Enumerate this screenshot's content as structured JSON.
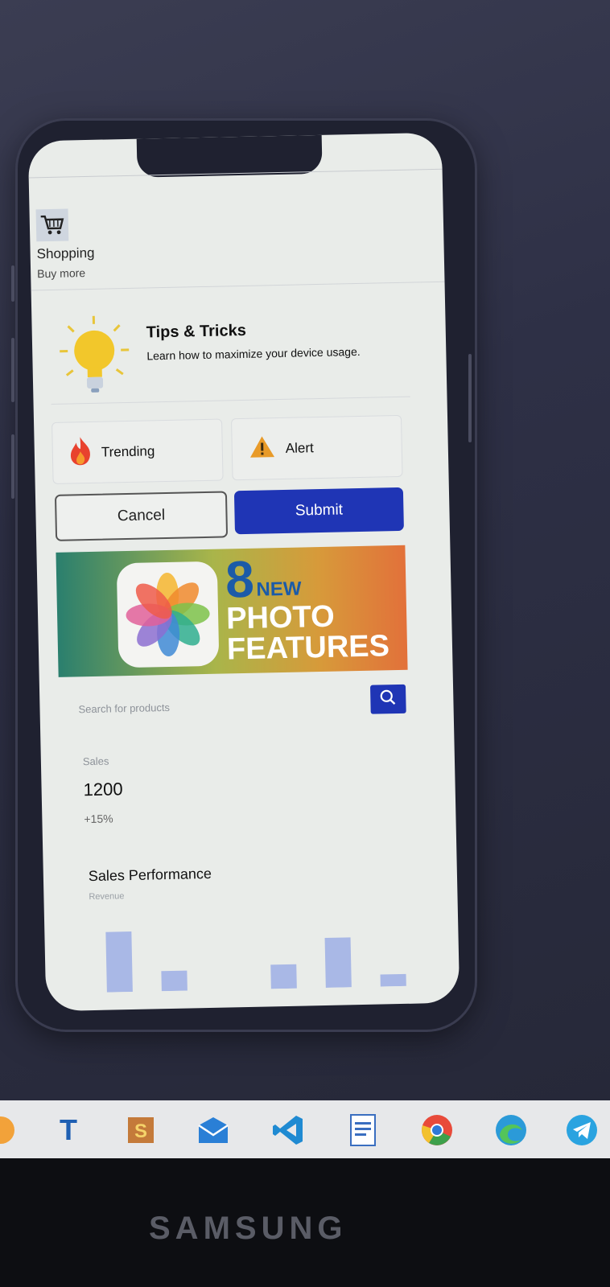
{
  "shopping": {
    "title": "Shopping",
    "subtitle": "Buy more",
    "icon": "cart-icon"
  },
  "tips": {
    "title": "Tips & Tricks",
    "text": "Learn how to maximize your device usage.",
    "icon": "lightbulb-icon"
  },
  "cards": {
    "trending": {
      "label": "Trending",
      "icon": "fire-icon"
    },
    "alert": {
      "label": "Alert",
      "icon": "warning-icon"
    }
  },
  "buttons": {
    "cancel": "Cancel",
    "submit": "Submit"
  },
  "banner": {
    "number": "8",
    "line1": "NEW",
    "line2": "PHOTO",
    "line3": "FEATURES",
    "icon": "photos-app-icon"
  },
  "search": {
    "placeholder": "Search for products",
    "icon": "search-icon"
  },
  "stat": {
    "label": "Sales",
    "value": "1200",
    "change": "+15%"
  },
  "chart_section": {
    "title": "Sales Performance",
    "subtitle": "Revenue"
  },
  "chart_data": {
    "type": "bar",
    "title": "Sales Performance",
    "ylabel": "Revenue",
    "values": [
      75,
      25,
      0,
      30,
      62,
      15
    ],
    "color": "#a9b8e6"
  },
  "taskbar": {
    "items": [
      "T",
      "S",
      "mail-icon",
      "vscode-icon",
      "document-icon",
      "chrome-icon",
      "edge-icon",
      "telegram-icon"
    ]
  },
  "monitor": {
    "brand": "SAMSUNG"
  },
  "colors": {
    "primary": "#1f35b5",
    "screen_bg": "#e9ece9"
  }
}
